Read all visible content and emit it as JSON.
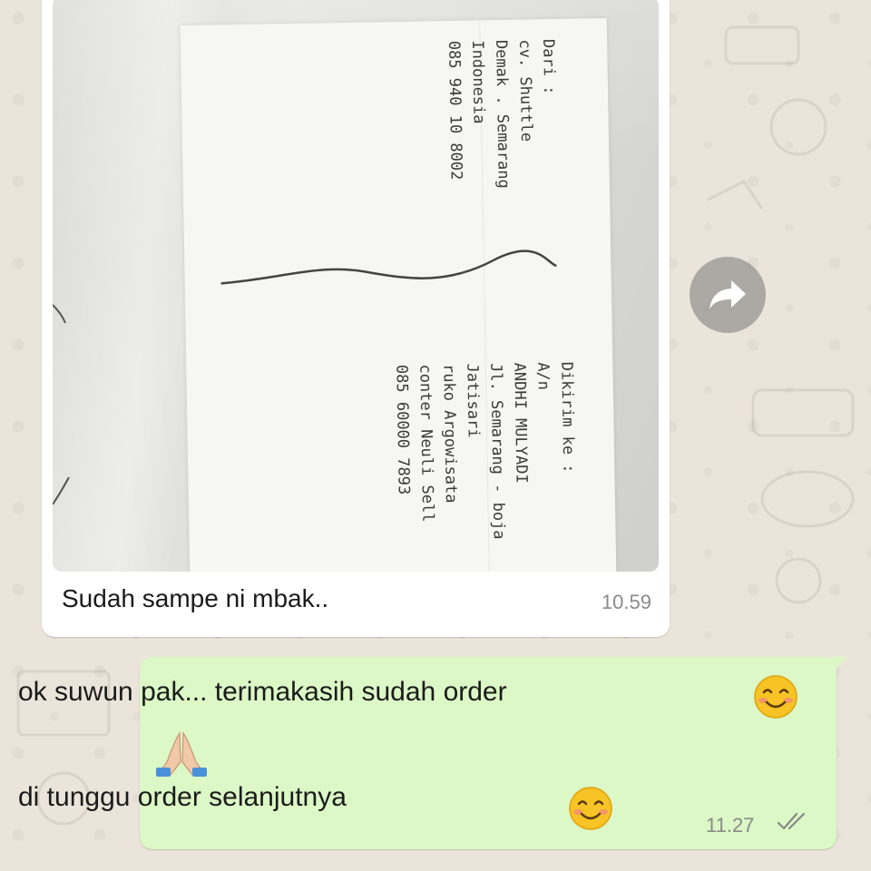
{
  "messages": {
    "incoming": {
      "caption": "Sudah sampe ni mbak..",
      "time": "10.59",
      "photo": {
        "sender_lines": [
          "Dari :",
          "cv. Shuttle",
          "Demak . Semarang",
          "Indonesia",
          "085 940 10 8002"
        ],
        "recipient_lines": [
          "Dikirim ke :",
          "A/n",
          "ANDHI MULYADI",
          "Jl. Semarang - boja",
          "Jatisari",
          "ruko Argowisata",
          "conter Neuli Sell",
          "085 60000 7893"
        ]
      }
    },
    "outgoing": {
      "line1": "ok suwun pak... terimakasih sudah order",
      "line2": "di tunggu order selanjutnya",
      "time": "11.27",
      "status": "double-check-icon"
    }
  },
  "icons": {
    "forward": "forward-icon",
    "smile": "smiling-face-emoji",
    "pray": "folded-hands-emoji"
  },
  "colors": {
    "incoming_bubble": "#ffffff",
    "outgoing_bubble": "#dcf8c6",
    "background": "#ece5dd"
  }
}
